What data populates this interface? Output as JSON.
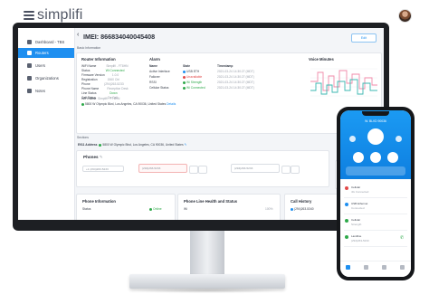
{
  "header": {
    "logo_text": "simplifi",
    "menu_icon": "hamburger-menu-icon",
    "avatar_icon": "user-avatar"
  },
  "sidebar": {
    "items": [
      {
        "label": "Dashboard - TBS",
        "icon": "dashboard-icon"
      },
      {
        "label": "Routers",
        "icon": "router-icon",
        "active": true
      },
      {
        "label": "Users",
        "icon": "users-icon"
      },
      {
        "label": "Organizations",
        "icon": "organization-icon"
      },
      {
        "label": "Notes",
        "icon": "notes-icon"
      }
    ]
  },
  "page": {
    "back_icon": "chevron-left-icon",
    "title": "IMEI: 866834040045408",
    "edit_button": "Edit"
  },
  "basic_info": {
    "section_label": "Basic Information",
    "router_info": {
      "title": "Router Information",
      "rows": [
        {
          "k": "WiFi Name",
          "v": "Simplifi - FT8HN"
        },
        {
          "k": "Status",
          "v": "Wi Connected"
        },
        {
          "k": "Firmware Version",
          "v": "1.0.0"
        },
        {
          "k": "Registration",
          "v": "1560 Ctrl"
        },
        {
          "k": "Phone",
          "v": "(294)263-5233"
        },
        {
          "k": "Phone Name",
          "v": "Reception Desk"
        },
        {
          "k": "Line Status",
          "v": "Down"
        },
        {
          "k": "Call Status",
          "v": "On Call"
        }
      ],
      "address": "5800 W Olympic Blvd, Los Angeles, CA 90036, United States",
      "address_link": "Details"
    },
    "alarm": {
      "title": "Alarm",
      "headers": [
        "Name",
        "State",
        "Timestamp"
      ],
      "rows": [
        {
          "name": "Active Interface",
          "state": "USB ETH",
          "ts": "2021-03-24 14:30:27 (MDT)"
        },
        {
          "name": "Failover",
          "state": "Unavailable",
          "ts": "2021-03-24 14:30:27 (MDT)"
        },
        {
          "name": "RSSI",
          "state": "Wi Strength",
          "ts": "2021-03-24 14:30:27 (MDT)"
        },
        {
          "name": "Cellular Status",
          "state": "Wi Connected",
          "ts": "2021-03-24 14:30:27 (MDT)"
        }
      ]
    },
    "voice_minutes": {
      "title": "Voice Minutes"
    }
  },
  "sections": {
    "section_label": "Sections",
    "e911_label": "E911 Address",
    "e911_value": "5800 W Olympic Blvd, Los Angeles, CA 90036, United States",
    "phones": {
      "title": "Phones",
      "fields": [
        "+1 (294)263-5233",
        "(294)263-5233",
        "(294)263-5233"
      ]
    },
    "phone_information": {
      "title": "Phone Information",
      "status_label": "Status",
      "status_value": "Online"
    },
    "phone_line_health": {
      "title": "Phone Line Health and Status",
      "first_value": "Wi",
      "percent": "100%"
    },
    "call_history": {
      "title": "Call History",
      "first_number": "(294)263-5340"
    }
  },
  "mobile": {
    "header_label": "W. BLVD 90036",
    "tiles": [
      "Power",
      "Phones",
      "Voice",
      "Network"
    ],
    "list": [
      {
        "label": "Cellular",
        "sub": "4G Connected"
      },
      {
        "label": "USB Ethernet",
        "sub": "Connected"
      },
      {
        "label": "Cellular",
        "sub": "Strength"
      },
      {
        "label": "Landline",
        "sub": "(294)263-5233"
      }
    ],
    "bottom_nav": [
      "Home",
      "Alerts",
      "Plans",
      "Settings"
    ]
  },
  "colors": {
    "accent": "#1e8ff0",
    "good": "#2ea94a",
    "bad": "#e24848"
  }
}
